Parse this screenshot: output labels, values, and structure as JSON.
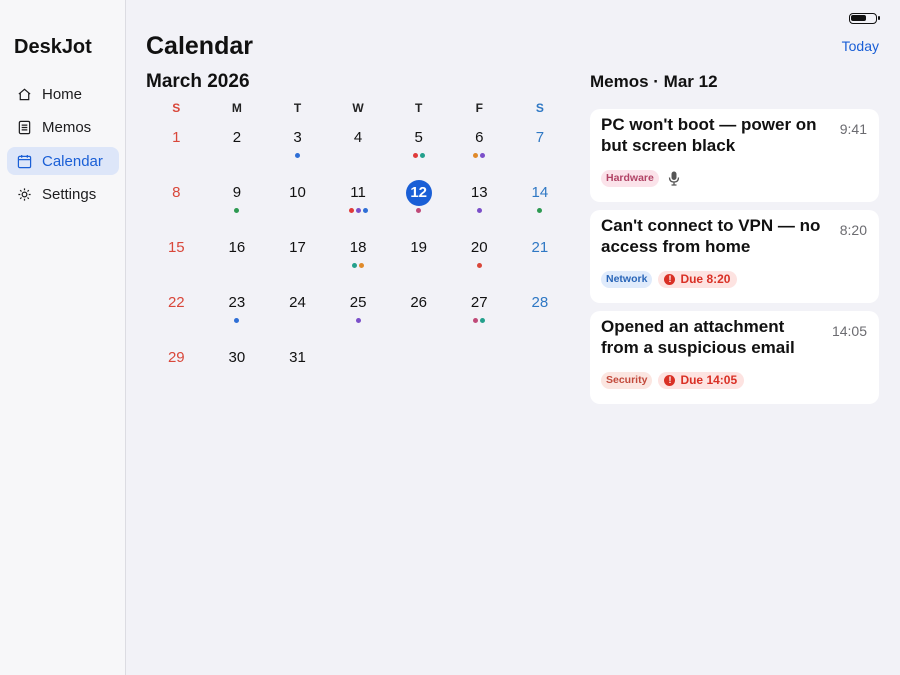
{
  "app": {
    "title": "DeskJot"
  },
  "sidebar": {
    "items": [
      {
        "label": "Home",
        "icon": "home-icon",
        "active": false
      },
      {
        "label": "Memos",
        "icon": "memo-icon",
        "active": false
      },
      {
        "label": "Calendar",
        "icon": "calendar-icon",
        "active": true
      },
      {
        "label": "Settings",
        "icon": "gear-icon",
        "active": false
      }
    ]
  },
  "header": {
    "title": "Calendar",
    "today_label": "Today"
  },
  "calendar": {
    "month_title": "March 2026",
    "weekdays": [
      "S",
      "M",
      "T",
      "W",
      "T",
      "F",
      "S"
    ],
    "selected_day": "12",
    "days": [
      {
        "label": "1",
        "dots": []
      },
      {
        "label": "2",
        "dots": []
      },
      {
        "label": "3",
        "dots": [
          "#2f6fd6"
        ]
      },
      {
        "label": "4",
        "dots": []
      },
      {
        "label": "5",
        "dots": [
          "#e03a3a",
          "#24a08c"
        ]
      },
      {
        "label": "6",
        "dots": [
          "#e08a2a",
          "#7b4fc9"
        ]
      },
      {
        "label": "7",
        "dots": []
      },
      {
        "label": "8",
        "dots": []
      },
      {
        "label": "9",
        "dots": [
          "#2e9a52"
        ]
      },
      {
        "label": "10",
        "dots": []
      },
      {
        "label": "11",
        "dots": [
          "#e03a3a",
          "#7b4fc9",
          "#2f6fd6"
        ]
      },
      {
        "label": "12",
        "dots": [
          "#c04a78"
        ]
      },
      {
        "label": "13",
        "dots": [
          "#7b4fc9"
        ]
      },
      {
        "label": "14",
        "dots": [
          "#2e9a52"
        ]
      },
      {
        "label": "15",
        "dots": []
      },
      {
        "label": "16",
        "dots": []
      },
      {
        "label": "17",
        "dots": []
      },
      {
        "label": "18",
        "dots": [
          "#24a08c",
          "#e08a2a"
        ]
      },
      {
        "label": "19",
        "dots": []
      },
      {
        "label": "20",
        "dots": [
          "#d9473a"
        ]
      },
      {
        "label": "21",
        "dots": []
      },
      {
        "label": "22",
        "dots": []
      },
      {
        "label": "23",
        "dots": [
          "#2f6fd6"
        ]
      },
      {
        "label": "24",
        "dots": []
      },
      {
        "label": "25",
        "dots": [
          "#7b4fc9"
        ]
      },
      {
        "label": "26",
        "dots": []
      },
      {
        "label": "27",
        "dots": [
          "#c04a78",
          "#24a08c"
        ]
      },
      {
        "label": "28",
        "dots": []
      },
      {
        "label": "29",
        "dots": []
      },
      {
        "label": "30",
        "dots": []
      },
      {
        "label": "31",
        "dots": []
      }
    ]
  },
  "memos": {
    "title": "Memos · Mar 12",
    "items": [
      {
        "title": "PC won't boot — power on but screen black",
        "time": "9:41",
        "tag": "Hardware",
        "tag_type": "hardware",
        "has_voice": true,
        "due": null
      },
      {
        "title": "Can't connect to VPN — no access from home",
        "time": "8:20",
        "tag": "Network",
        "tag_type": "network",
        "has_voice": false,
        "due": "Due 8:20"
      },
      {
        "title": "Opened an attachment from a suspicious email",
        "time": "14:05",
        "tag": "Security",
        "tag_type": "security",
        "has_voice": false,
        "due": "Due 14:05"
      }
    ]
  },
  "colors": {
    "accent": "#1a5fd6",
    "sunday": "#d9473a",
    "saturday": "#2f78c4",
    "due": "#d93025"
  }
}
